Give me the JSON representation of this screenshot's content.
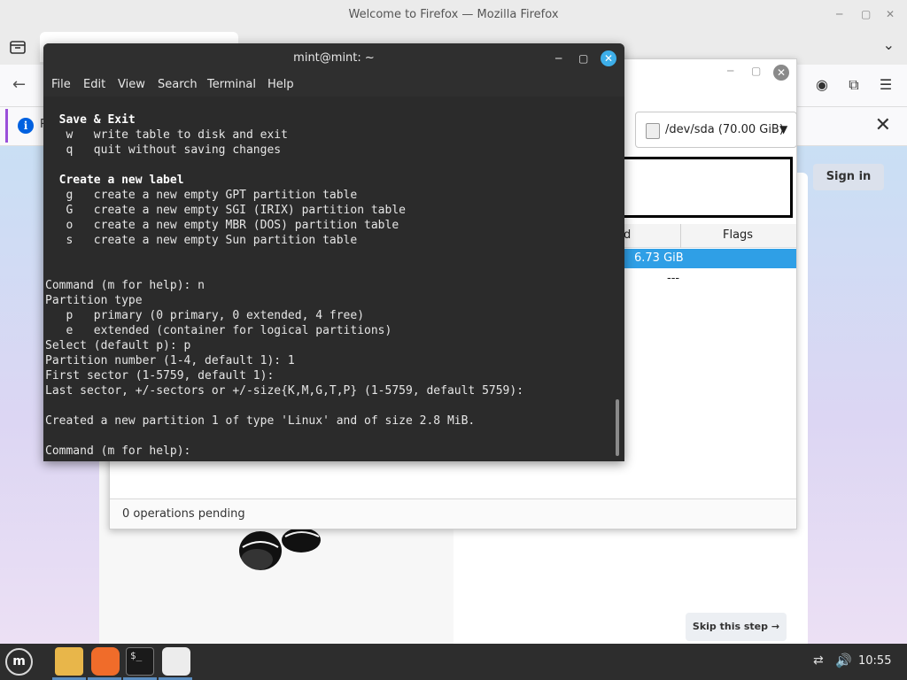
{
  "firefox": {
    "window_title": "Welcome to Firefox — Mozilla Firefox",
    "notification_prefix": "R",
    "sign_in_label": "Sign in",
    "skip_label": "Skip this step →"
  },
  "gparted": {
    "device_label": "/dev/sda (70.00 GiB)",
    "columns": {
      "used_partial": "ed",
      "flags": "Flags"
    },
    "rows": [
      {
        "used": "6.73 GiB",
        "selected": true
      },
      {
        "used": "---",
        "selected": false
      }
    ],
    "status": "0 operations pending"
  },
  "terminal": {
    "title": "mint@mint: ~",
    "menu": [
      "File",
      "Edit",
      "View",
      "Search",
      "Terminal",
      "Help"
    ],
    "lines": [
      {
        "text": "  Save & Exit",
        "bold": true
      },
      {
        "text": "   w   write table to disk and exit"
      },
      {
        "text": "   q   quit without saving changes"
      },
      {
        "text": ""
      },
      {
        "text": "  Create a new label",
        "bold": true
      },
      {
        "text": "   g   create a new empty GPT partition table"
      },
      {
        "text": "   G   create a new empty SGI (IRIX) partition table"
      },
      {
        "text": "   o   create a new empty MBR (DOS) partition table"
      },
      {
        "text": "   s   create a new empty Sun partition table"
      },
      {
        "text": ""
      },
      {
        "text": ""
      },
      {
        "text": "Command (m for help): n"
      },
      {
        "text": "Partition type"
      },
      {
        "text": "   p   primary (0 primary, 0 extended, 4 free)"
      },
      {
        "text": "   e   extended (container for logical partitions)"
      },
      {
        "text": "Select (default p): p"
      },
      {
        "text": "Partition number (1-4, default 1): 1"
      },
      {
        "text": "First sector (1-5759, default 1):"
      },
      {
        "text": "Last sector, +/-sectors or +/-size{K,M,G,T,P} (1-5759, default 5759):"
      },
      {
        "text": ""
      },
      {
        "text": "Created a new partition 1 of type 'Linux' and of size 2.8 MiB."
      },
      {
        "text": ""
      },
      {
        "text": "Command (m for help): "
      }
    ]
  },
  "taskbar": {
    "terminal_icon_text": "$_",
    "clock": "10:55",
    "icons": [
      "mint-menu-icon",
      "folder-icon",
      "firefox-icon",
      "terminal-icon",
      "gparted-icon",
      "network-icon",
      "volume-icon"
    ]
  },
  "colors": {
    "terminal_bg": "#2b2b2b",
    "selection_blue": "#2f9fe6",
    "close_button_blue": "#3daee9",
    "taskbar_bg": "#2d2d2d"
  }
}
